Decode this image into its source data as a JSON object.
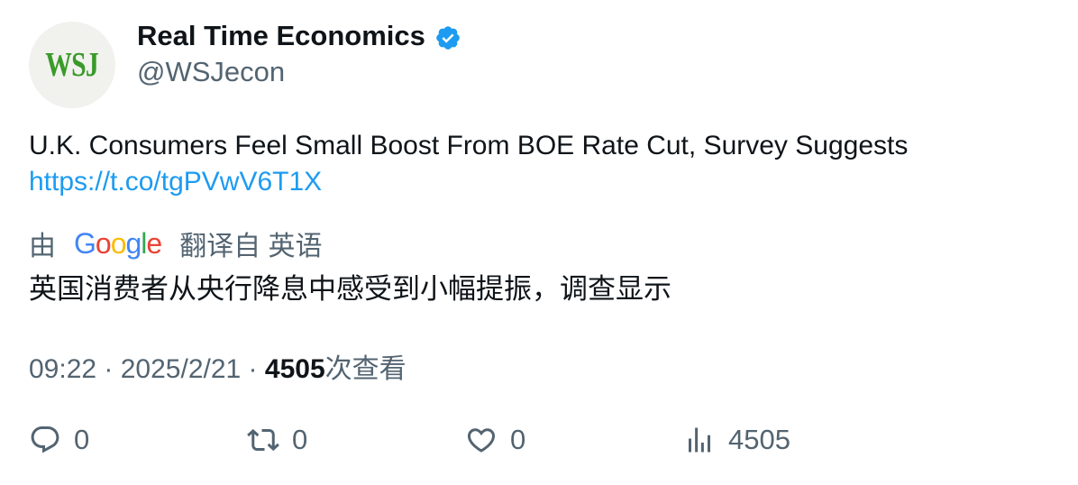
{
  "author": {
    "avatar_text": "WSJ",
    "name": "Real Time Economics",
    "handle": "@WSJecon",
    "verified_icon": "verified-badge-icon"
  },
  "tweet": {
    "text": "U.K. Consumers Feel Small Boost From BOE Rate Cut, Survey Suggests",
    "link": "https://t.co/tgPVwV6T1X"
  },
  "translation": {
    "prefix": "由",
    "provider": "Google",
    "suffix": "翻译自 英语",
    "text": "英国消费者从央行降息中感受到小幅提振，调查显示"
  },
  "meta": {
    "time": "09:22",
    "sep1": " · ",
    "date": "2025/2/21",
    "sep2": " · ",
    "views": "4505",
    "views_label": "次查看"
  },
  "actions": {
    "reply_count": "0",
    "retweet_count": "0",
    "like_count": "0",
    "views_count": "4505"
  },
  "colors": {
    "accent": "#1d9bf0",
    "secondary_text": "#536471",
    "primary_text": "#0f1419"
  }
}
